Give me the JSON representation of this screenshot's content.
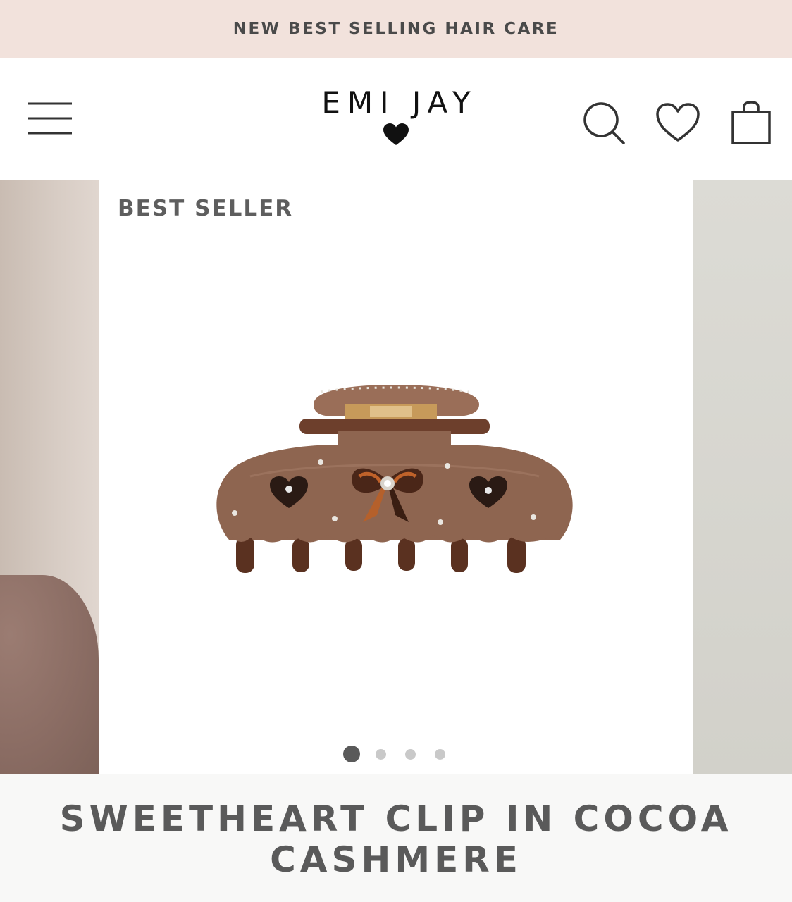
{
  "announcement": {
    "text": "NEW BEST SELLING HAIR CARE"
  },
  "header": {
    "logo_text": "EMI JAY",
    "icons": {
      "menu": "hamburger-menu-icon",
      "logo_mark": "heart-icon",
      "search": "search-icon",
      "wishlist": "heart-outline-icon",
      "cart": "shopping-bag-icon"
    }
  },
  "product": {
    "badge": "BEST SELLER",
    "title": "SWEETHEART CLIP IN COCOA CASHMERE",
    "image_count": 4,
    "active_image": 1
  },
  "colors": {
    "announcement_bg": "#f2e2dc",
    "text_gray": "#5a5a5a",
    "clip_brown": "#8e6550",
    "title_bar_bg": "#f8f8f7"
  }
}
